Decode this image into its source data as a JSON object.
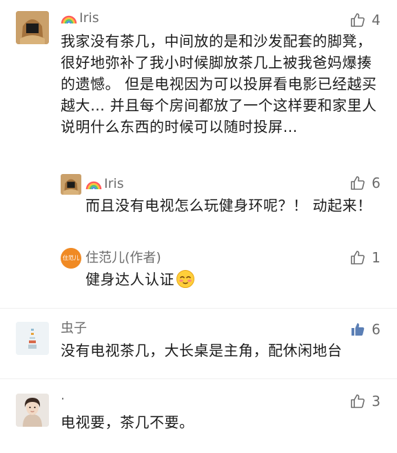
{
  "comments": [
    {
      "author": "Iris",
      "text": "我家没有茶几，中间放的是和沙发配套的脚凳，很好地弥补了我小时候脚放茶几上被我爸妈爆揍的遗憾。 但是电视因为可以投屏看电影已经越买越大… 并且每个房间都放了一个这样要和家里人说明什么东西的时候可以随时投屏…",
      "likes": "4"
    },
    {
      "author": "Iris",
      "text": "而且没有电视怎么玩健身环呢？！ 动起来！",
      "likes": "6"
    },
    {
      "author": "住范儿(作者)",
      "avatar_text": "住范儿",
      "text": "健身达人认证",
      "likes": "1"
    },
    {
      "author": "虫子",
      "text": "没有电视茶几，大长桌是主角，配休闲地台",
      "likes": "6"
    },
    {
      "author": "·",
      "text": "电视要，茶几不要。",
      "likes": "3"
    }
  ],
  "colors": {
    "brand_orange": "#f08a24",
    "liked_blue": "#5b7fb5",
    "muted": "#6e6e6e"
  }
}
